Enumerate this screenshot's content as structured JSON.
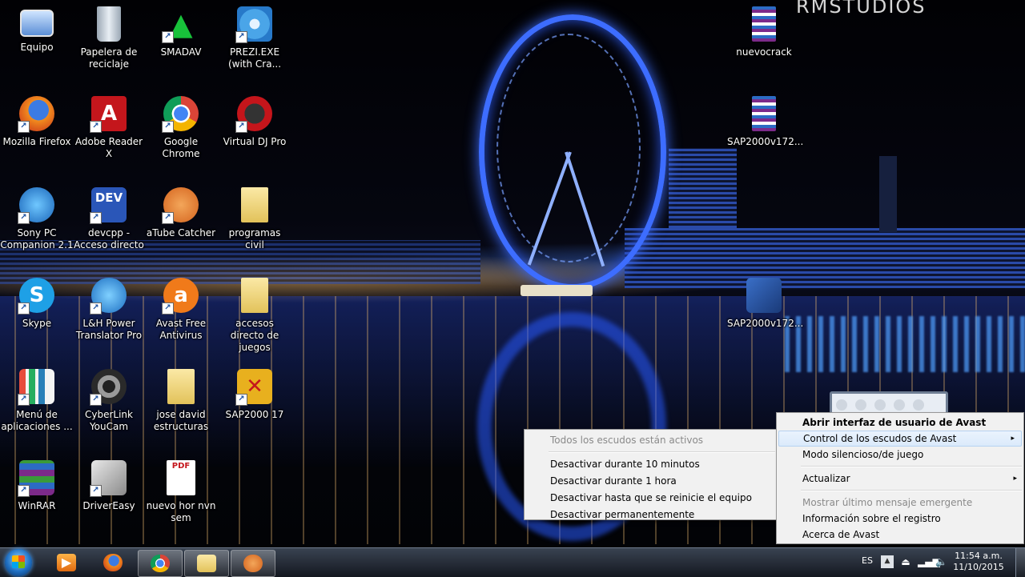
{
  "wallpaper": {
    "brand_text": "RMSTUDIOS"
  },
  "desktop_icons": [
    {
      "label": "Equipo"
    },
    {
      "label": "Papelera de reciclaje"
    },
    {
      "label": "SMADAV"
    },
    {
      "label": "PREZI.EXE (with Cra..."
    },
    {
      "label": "Mozilla Firefox"
    },
    {
      "label": "Adobe Reader X"
    },
    {
      "label": "Google Chrome"
    },
    {
      "label": "Virtual DJ Pro"
    },
    {
      "label": "Sony PC Companion 2.1"
    },
    {
      "label": "devcpp - Acceso directo"
    },
    {
      "label": "aTube Catcher"
    },
    {
      "label": "programas civil"
    },
    {
      "label": "Skype"
    },
    {
      "label": "L&H Power Translator Pro"
    },
    {
      "label": "Avast Free Antivirus"
    },
    {
      "label": "accesos directo de juegos"
    },
    {
      "label": "Menú de aplicaciones ..."
    },
    {
      "label": "CyberLink YouCam"
    },
    {
      "label": "jose david estructuras"
    },
    {
      "label": "SAP2000 17"
    },
    {
      "label": "WinRAR"
    },
    {
      "label": "DriverEasy"
    },
    {
      "label": "nuevo hor nvn sem"
    },
    {
      "label": "nuevocrack"
    },
    {
      "label": "SAP2000v172..."
    },
    {
      "label": "SAP2000v172..."
    }
  ],
  "shields_submenu": {
    "items": [
      {
        "label": "Todos los escudos están activos"
      },
      {
        "label": "Desactivar durante 10 minutos"
      },
      {
        "label": "Desactivar durante 1 hora"
      },
      {
        "label": "Desactivar hasta que se reinicie el equipo"
      },
      {
        "label": "Desactivar permanentemente"
      }
    ]
  },
  "avast_menu": {
    "items": [
      {
        "label": "Abrir interfaz de usuario de Avast"
      },
      {
        "label": "Control de los escudos de Avast"
      },
      {
        "label": "Modo silencioso/de juego"
      },
      {
        "label": "Actualizar"
      },
      {
        "label": "Mostrar último mensaje emergente"
      },
      {
        "label": "Información sobre el registro"
      },
      {
        "label": "Acerca de Avast"
      }
    ],
    "submenu_arrow": "▸"
  },
  "taskbar": {
    "language": "ES",
    "time": "11:54 a.m.",
    "date": "11/10/2015"
  },
  "colors": {
    "accent_blue": "#3d6dff",
    "menu_bg": "#f1f1f1",
    "menu_highlight": "#dbeafb"
  }
}
